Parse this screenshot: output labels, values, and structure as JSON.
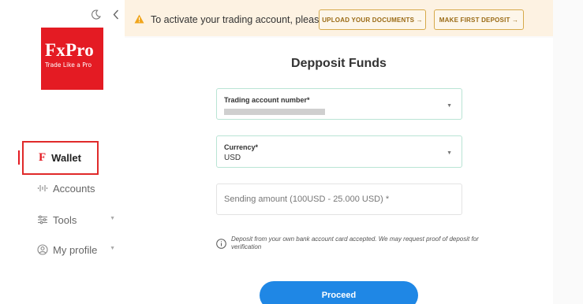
{
  "sidebar": {
    "logo": {
      "name": "FxPro",
      "tagline": "Trade Like a Pro"
    },
    "top_icons": [
      "moon-icon",
      "chevron-left-icon"
    ],
    "items": [
      {
        "label": "Wallet",
        "icon": "fxpro-f-icon",
        "active": true
      },
      {
        "label": "Accounts",
        "icon": "accounts-icon"
      },
      {
        "label": "Tools",
        "icon": "tools-icon",
        "expandable": true
      },
      {
        "label": "My profile",
        "icon": "profile-icon",
        "expandable": true
      }
    ]
  },
  "alert": {
    "icon": "warning-icon",
    "text": "To activate your trading account, please",
    "buttons": [
      {
        "label": "UPLOAD YOUR DOCUMENTS →"
      },
      {
        "label": "MAKE FIRST DEPOSIT →"
      }
    ]
  },
  "form": {
    "title": "Depposit Funds",
    "trading_account": {
      "label": "Trading account number*",
      "value": ""
    },
    "currency": {
      "label": "Currency*",
      "value": "USD"
    },
    "amount": {
      "placeholder": "Sending amount (100USD - 25.000 USD) *"
    },
    "note": "Deposit from your own bank account card accepted. We  may request proof of deposit for verification",
    "proceed_label": "Proceed"
  },
  "colors": {
    "brand": "#e41b23",
    "alert_bg": "#fdf2e2",
    "primary_button": "#1f87e5",
    "field_border": "#b9e4d4"
  }
}
